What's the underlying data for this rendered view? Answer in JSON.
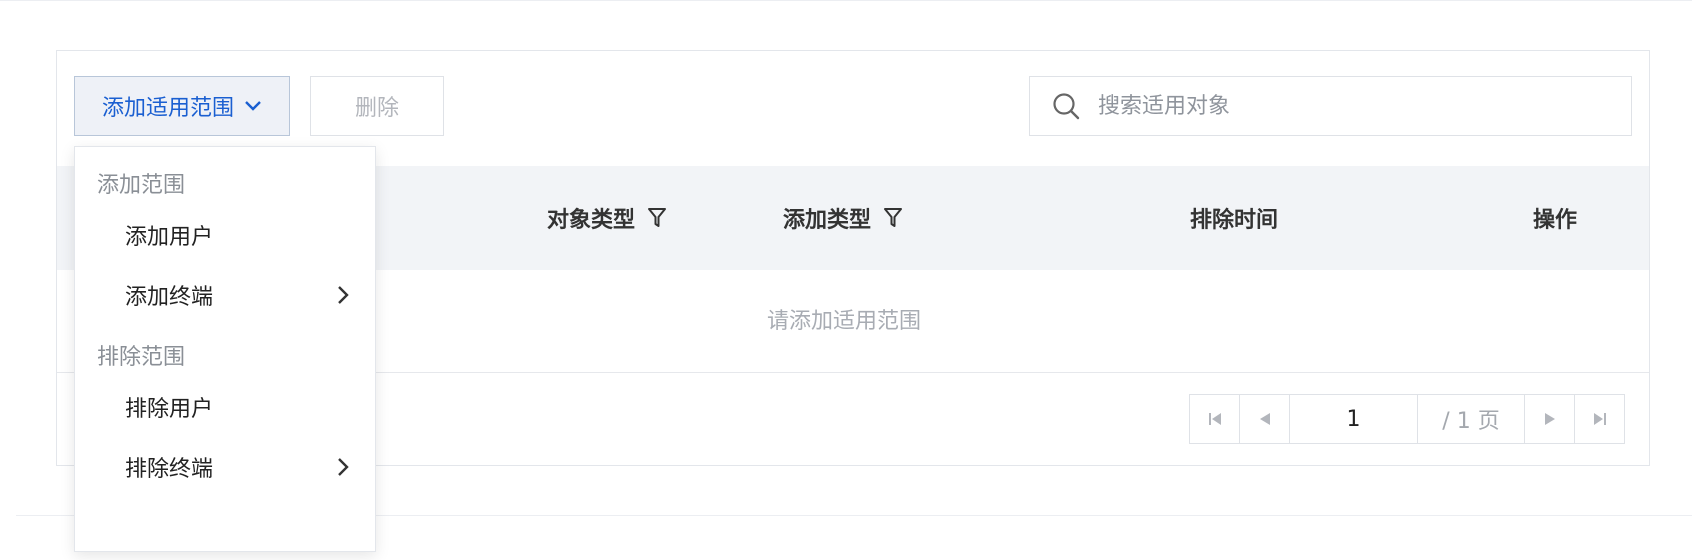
{
  "toolbar": {
    "scope_button_label": "添加适用范围",
    "delete_button_label": "删除"
  },
  "search": {
    "placeholder": "搜索适用对象",
    "value": ""
  },
  "table": {
    "columns": [
      "对象类型",
      "添加类型",
      "排除时间",
      "操作"
    ],
    "empty_text": "请添加适用范围"
  },
  "pagination": {
    "current_page": "1",
    "total_label": "/ 1 页"
  },
  "dropdown": {
    "groups": [
      {
        "label": "添加范围",
        "items": [
          {
            "label": "添加用户"
          },
          {
            "label": "添加终端"
          }
        ]
      },
      {
        "label": "排除范围",
        "items": [
          {
            "label": "排除用户"
          },
          {
            "label": "排除终端"
          }
        ]
      }
    ]
  },
  "icons": {
    "scope_button": "chevron-down-icon",
    "search": "search-icon",
    "column_filter": "filter-icon",
    "submenu": "chevron-right-icon",
    "pager": [
      "first-page-icon",
      "prev-page-icon",
      "next-page-icon",
      "last-page-icon"
    ]
  },
  "colors": {
    "accent": "#1a5fd1",
    "header_bg": "#f2f4f7",
    "muted_text": "#a8acb3",
    "border": "#dfe2e7"
  }
}
